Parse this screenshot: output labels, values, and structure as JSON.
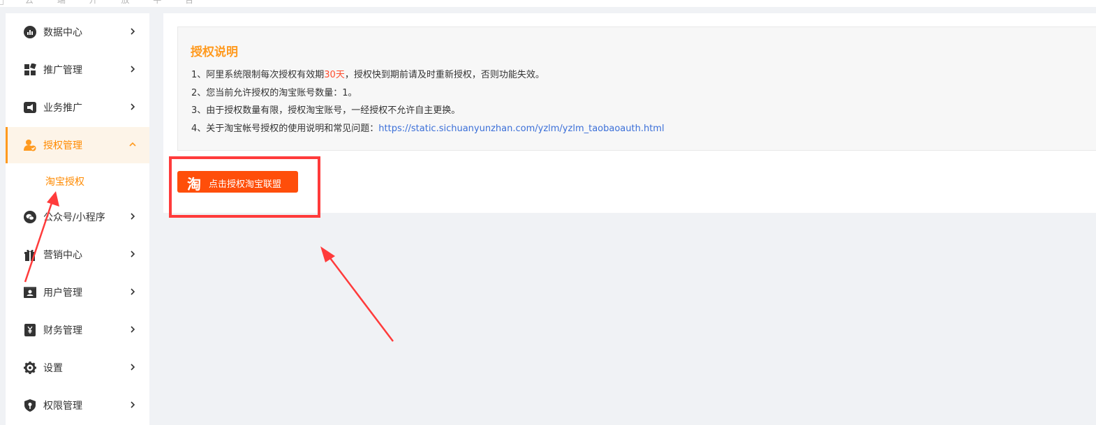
{
  "header": {
    "brand_text": "云 端 开 放 平 台"
  },
  "sidebar": {
    "items": [
      {
        "label": "数据中心",
        "icon": "chart-icon"
      },
      {
        "label": "推广管理",
        "icon": "grid-icon"
      },
      {
        "label": "业务推广",
        "icon": "megaphone-icon"
      },
      {
        "label": "授权管理",
        "icon": "user-check-icon",
        "active": true,
        "expanded": true
      },
      {
        "label": "公众号/小程序",
        "icon": "wechat-icon"
      },
      {
        "label": "营销中心",
        "icon": "gift-icon"
      },
      {
        "label": "用户管理",
        "icon": "user-card-icon"
      },
      {
        "label": "财务管理",
        "icon": "yuan-icon"
      },
      {
        "label": "设置",
        "icon": "gear-icon"
      },
      {
        "label": "权限管理",
        "icon": "shield-icon"
      }
    ],
    "submenu": {
      "label": "淘宝授权"
    }
  },
  "notice": {
    "title": "授权说明",
    "line1_pre": "1、阿里系统限制每次授权有效期",
    "line1_hl": "30天",
    "line1_post": "，授权快到期前请及时重新授权，否则功能失效。",
    "line2": "2、您当前允许授权的淘宝账号数量：1。",
    "line3": "3、由于授权数量有限，授权淘宝账号，一经授权不允许自主更换。",
    "line4_pre": "4、关于淘宝帐号授权的使用说明和常见问题：",
    "line4_link": "https://static.sichuanyunzhan.com/yzlm/yzlm_taobaoauth.html"
  },
  "auth_button": {
    "icon_char": "淘",
    "label": "点击授权淘宝联盟"
  },
  "colors": {
    "accent": "#ff9a1f",
    "button": "#ff4e0a",
    "annotation": "#ff3b3b",
    "link": "#3b6fd8"
  }
}
